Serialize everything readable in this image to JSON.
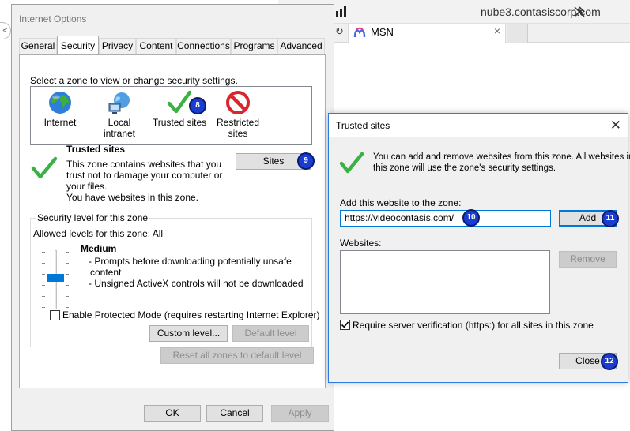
{
  "browser": {
    "host": "nube3.contasiscorp.com",
    "tab_label": "MSN",
    "tab_close": "×",
    "left_arrow": "<"
  },
  "io": {
    "title": "Internet Options",
    "tabs": [
      "General",
      "Security",
      "Privacy",
      "Content",
      "Connections",
      "Programs",
      "Advanced"
    ],
    "select_zone_text": "Select a zone to view or change security settings.",
    "zones": [
      "Internet",
      "Local intranet",
      "Trusted sites",
      "Restricted sites"
    ],
    "zone_heading": "Trusted sites",
    "zone_desc": [
      "This zone contains websites that you",
      "trust not to damage your computer or",
      "your files.",
      "You have websites in this zone."
    ],
    "sites_button": "Sites",
    "security_group_title": "Security level for this zone",
    "allowed_levels": "Allowed levels for this zone: All",
    "level_name": "Medium",
    "level_bullets": [
      "- Prompts before downloading potentially unsafe",
      "content",
      "- Unsigned ActiveX controls will not be downloaded"
    ],
    "protected_mode_label": "Enable Protected Mode (requires restarting Internet Explorer)",
    "custom_level_button": "Custom level...",
    "default_level_button": "Default level",
    "reset_all_button": "Reset all zones to default level",
    "ok_button": "OK",
    "cancel_button": "Cancel",
    "apply_button": "Apply"
  },
  "ts": {
    "title": "Trusted sites",
    "close_glyph": "✕",
    "info_line1": "You can add and remove websites from this zone. All websites in",
    "info_line2": "this zone will use the zone's security settings.",
    "add_label": "Add this website to the zone:",
    "input_value": "https://videocontasis.com/",
    "add_button": "Add",
    "websites_label": "Websites:",
    "remove_button": "Remove",
    "require_https_label": "Require server verification (https:) for all sites in this zone",
    "close_button": "Close"
  },
  "steps": [
    "8",
    "9",
    "10",
    "11",
    "12"
  ],
  "colors": {
    "accent": "#0078d7",
    "step_badge": "#1a3dd1",
    "trusted_check": "#3cb043",
    "restricted_red": "#d9262c"
  }
}
